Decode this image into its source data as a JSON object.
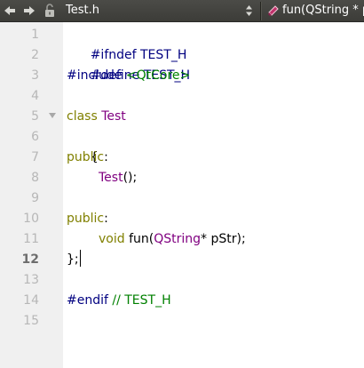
{
  "toolbar": {
    "back_icon": "arrow-left-icon",
    "forward_icon": "arrow-right-icon",
    "lock_icon": "unlocked-icon",
    "file_name": "Test.h",
    "symbol_icon": "method-icon",
    "symbol_name": "fun(QString * pStr)"
  },
  "colors": {
    "preprocessor": "#000080",
    "keyword": "#808000",
    "type": "#800080",
    "include_path": "#008000",
    "comment": "#008000",
    "line_number": "#b7b7b7",
    "current_line_number": "#6d6d6d",
    "gutter_bg": "#f0f0f0",
    "toolbar_bg": "#3c3c38"
  },
  "editor": {
    "current_line": 12,
    "line_numbers": [
      "1",
      "2",
      "3",
      "4",
      "5",
      "6",
      "7",
      "8",
      "9",
      "10",
      "11",
      "12",
      "13",
      "14",
      "15"
    ],
    "lines": {
      "l1": {
        "text": "#ifndef TEST_H"
      },
      "l2": {
        "text": "#define TEST_H"
      },
      "l3": {
        "directive": "#include",
        "path": "<QtCore>"
      },
      "l5": {
        "keyword": "class",
        "name": "Test"
      },
      "l6": {
        "text": "{"
      },
      "l7": {
        "keyword": "public",
        "punct": ":"
      },
      "l8": {
        "name": "Test",
        "rest": "();"
      },
      "l10": {
        "keyword": "public",
        "punct": ":"
      },
      "l11": {
        "type": "void",
        "fn": "fun(",
        "param_type": "QString",
        "rest": "* pStr);"
      },
      "l12": {
        "text": "};"
      },
      "l14": {
        "directive": "#endif",
        "comment": "// TEST_H"
      }
    }
  }
}
